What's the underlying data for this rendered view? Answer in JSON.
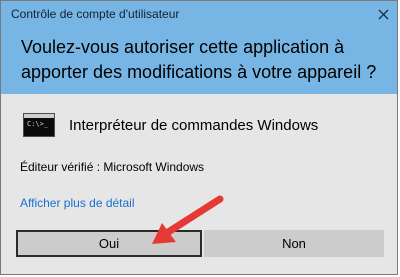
{
  "dialog": {
    "title": "Contrôle de compte d'utilisateur",
    "question": "Voulez-vous autoriser cette application à apporter des modifications à votre appareil ?",
    "close_icon": "close-icon",
    "header_color": "#77b6e4"
  },
  "app": {
    "icon": "command-prompt-icon",
    "icon_text": "C:\\>_",
    "name": "Interpréteur de commandes Windows"
  },
  "publisher": "Éditeur vérifié : Microsoft Windows",
  "details_link": "Afficher plus de détail",
  "buttons": {
    "yes": "Oui",
    "no": "Non"
  },
  "annotation": {
    "icon": "red-arrow-icon",
    "color": "#e53935"
  }
}
